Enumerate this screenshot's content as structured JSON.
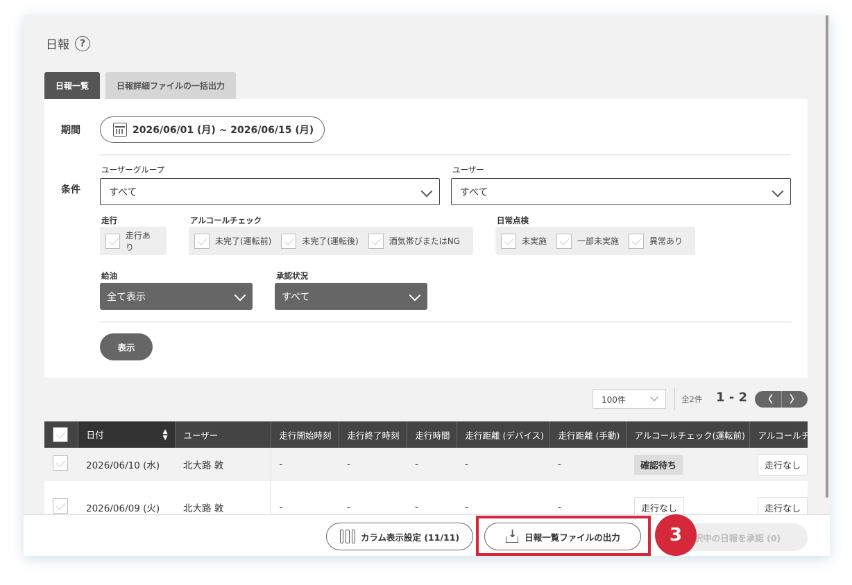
{
  "page": {
    "title": "日報",
    "help_icon": "?"
  },
  "tabs": [
    {
      "label": "日報一覧",
      "active": true
    },
    {
      "label": "日報詳細ファイルの一括出力",
      "active": false
    }
  ],
  "filters": {
    "period_label": "期間",
    "period_value": "2026/06/01 (月) ~ 2026/06/15 (月)",
    "conditions_label": "条件",
    "user_group": {
      "label": "ユーザーグループ",
      "value": "すべて"
    },
    "user": {
      "label": "ユーザー",
      "value": "すべて"
    },
    "driving": {
      "label": "走行",
      "options": [
        "走行あり"
      ]
    },
    "alcohol": {
      "label": "アルコールチェック",
      "options": [
        "未完了(運転前)",
        "未完了(運転後)",
        "酒気帯びまたはNG"
      ]
    },
    "daily_inspection": {
      "label": "日常点検",
      "options": [
        "未実施",
        "一部未実施",
        "異常あり"
      ]
    },
    "refuel": {
      "label": "給油",
      "value": "全て表示"
    },
    "approval": {
      "label": "承認状況",
      "value": "すべて"
    },
    "show_button": "表示"
  },
  "pagination": {
    "per_page": "100件",
    "total": "全2件",
    "range": "1 - 2",
    "prev": "〈",
    "next": "〉"
  },
  "table": {
    "headers": [
      "日付",
      "ユーザー",
      "走行開始時刻",
      "走行終了時刻",
      "走行時間",
      "走行距離 (デバイス)",
      "走行距離 (手動)",
      "アルコールチェック(運転前)",
      "アルコールチ"
    ],
    "rows": [
      {
        "date": "2026/06/10 (水)",
        "user": "北大路 敦",
        "start": "-",
        "end": "-",
        "duration": "-",
        "dist_device": "-",
        "dist_manual": "-",
        "alcohol_before": "確認待ち",
        "alcohol_after": "走行なし"
      },
      {
        "date": "2026/06/09 (火)",
        "user": "北大路 敦",
        "start": "-",
        "end": "-",
        "duration": "-",
        "dist_device": "-",
        "dist_manual": "-",
        "alcohol_before": "走行なし",
        "alcohol_after": "走行なし"
      }
    ]
  },
  "footer": {
    "column_settings": "カラム表示設定 (11/11)",
    "export": "日報一覧ファイルの出力",
    "approve": "択中の日報を承認 (0)"
  },
  "annotation": {
    "step": "3",
    "color": "#d6283b"
  }
}
